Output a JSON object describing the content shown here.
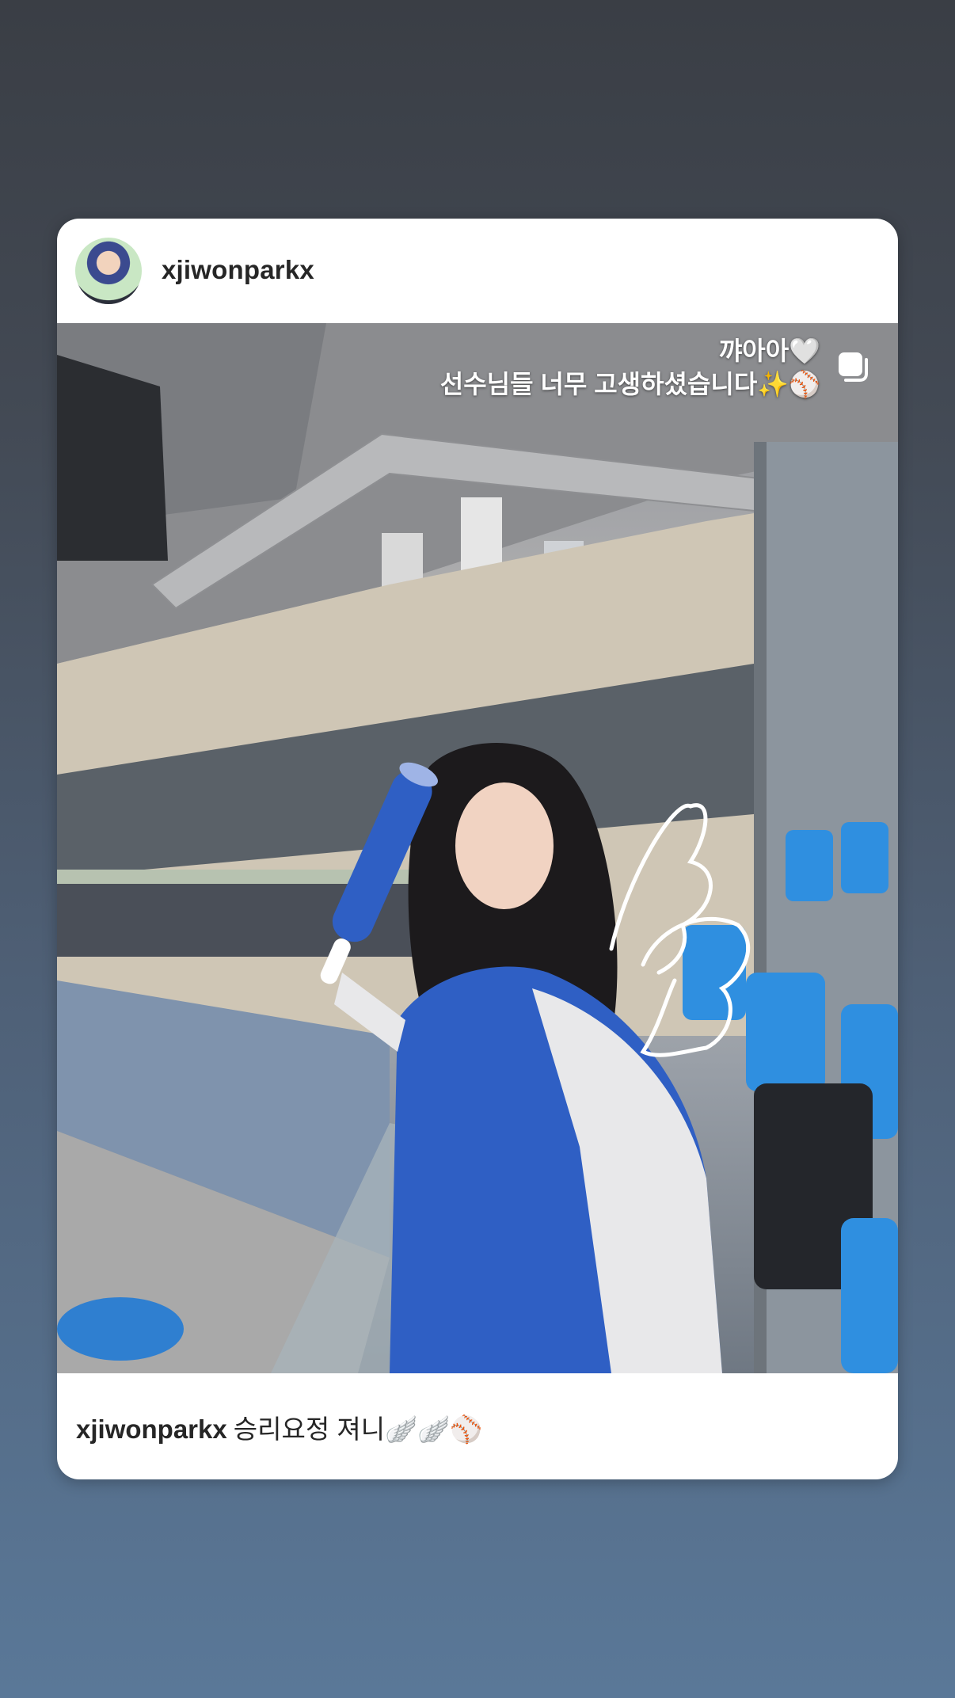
{
  "story": {
    "username": "xjiwonparkx",
    "overlay": {
      "line1": "꺄아아🤍",
      "line2": "선수님들 너무 고생하셨습니다✨⚾"
    },
    "caption": {
      "username": "xjiwonparkx",
      "text": "승리요정 져니🪽🪽⚾"
    }
  },
  "icons": [
    "avatar",
    "copy-icon",
    "wing-doodle",
    "baseball-emoji",
    "sparkles-emoji",
    "white-heart-emoji"
  ],
  "colors": {
    "background_top": "#3a3e45",
    "background_bottom": "#5a7898",
    "card": "#ffffff",
    "text": "#262626",
    "jacket_blue": "#2f5fc4",
    "seat_blue": "#2f8fe0"
  }
}
